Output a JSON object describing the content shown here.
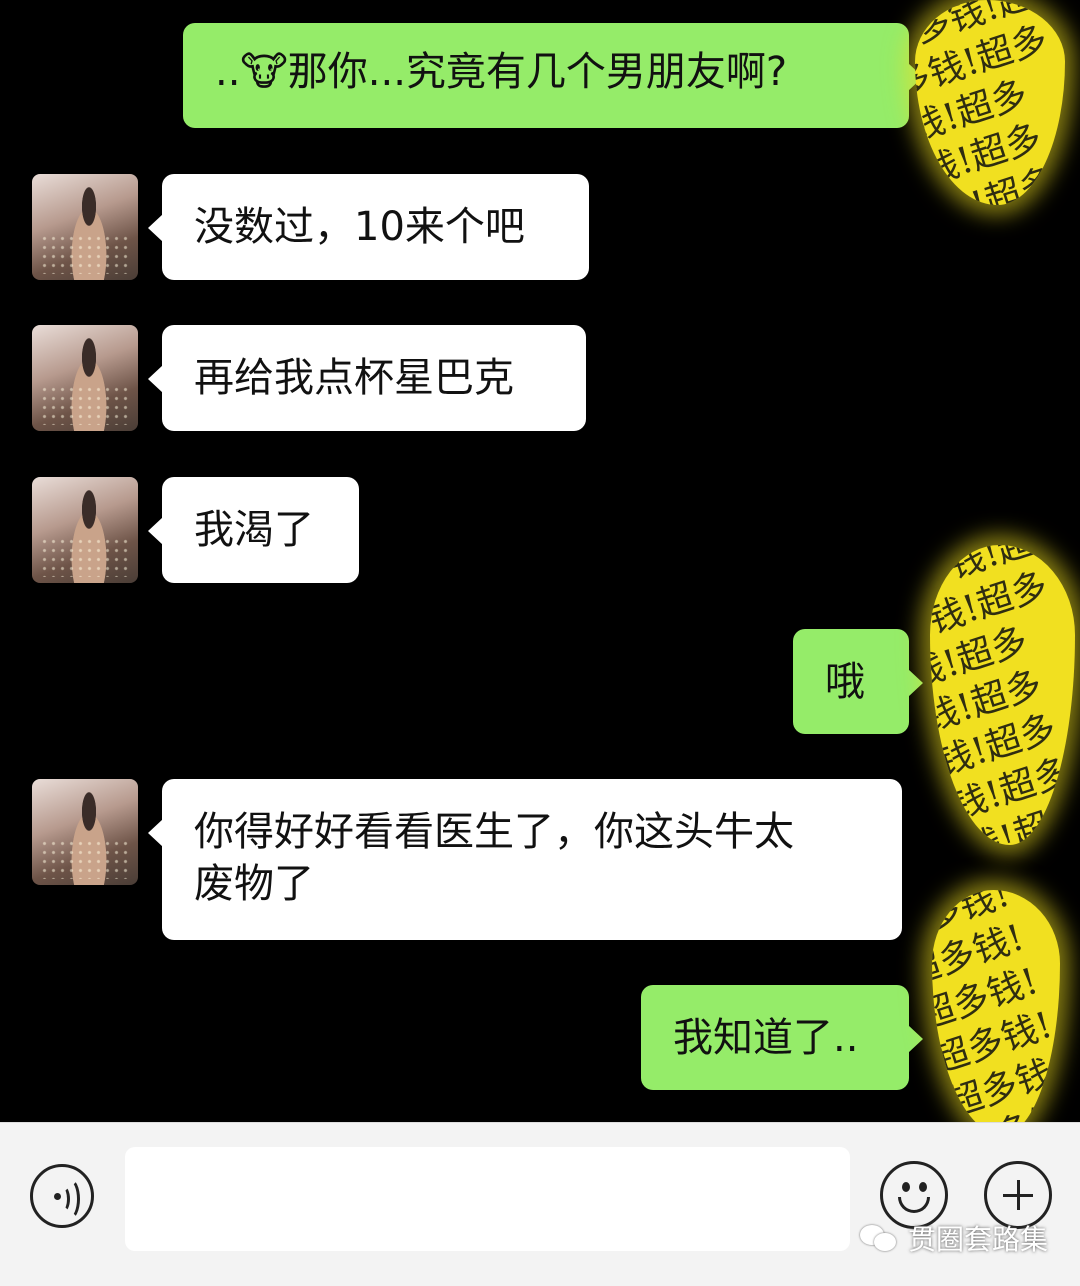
{
  "messages": [
    {
      "side": "right",
      "text": "..🐮那你...究竟有几个男朋友啊?"
    },
    {
      "side": "left",
      "text": "没数过，10来个吧"
    },
    {
      "side": "left",
      "text": "再给我点杯星巴克"
    },
    {
      "side": "left",
      "text": "我渴了"
    },
    {
      "side": "right",
      "text": "哦"
    },
    {
      "side": "left",
      "text": "你得好好看看医生了，你这头牛太\n废物了"
    },
    {
      "side": "right",
      "text": "我知道了.."
    }
  ],
  "redaction_pattern": "超多钱!超多钱!超多钱!超多钱!超多钱!超多钱!超多钱!超多钱!超多钱!超多钱!超多钱!超多钱!超多钱!",
  "input": {
    "value": "",
    "placeholder": ""
  },
  "watermark": "贯圈套路集",
  "colors": {
    "right_bubble": "#95ec69",
    "left_bubble": "#ffffff",
    "background": "#000000",
    "redaction": "#f1e020"
  }
}
